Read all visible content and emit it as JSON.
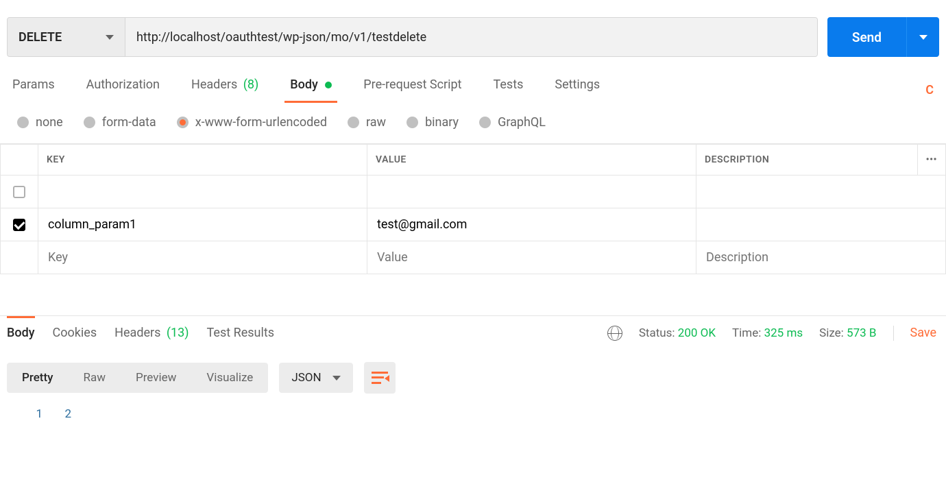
{
  "request": {
    "method": "DELETE",
    "url": "http://localhost/oauthtest/wp-json/mo/v1/testdelete",
    "send_label": "Send"
  },
  "request_tabs": {
    "params": "Params",
    "authorization": "Authorization",
    "headers": "Headers",
    "headers_count": "(8)",
    "body": "Body",
    "prerequest": "Pre-request Script",
    "tests": "Tests",
    "settings": "Settings",
    "right_action": "C"
  },
  "body_types": {
    "none": "none",
    "formdata": "form-data",
    "urlenc": "x-www-form-urlencoded",
    "raw": "raw",
    "binary": "binary",
    "graphql": "GraphQL"
  },
  "kv": {
    "headers": {
      "key": "KEY",
      "value": "VALUE",
      "desc": "DESCRIPTION"
    },
    "rows": [
      {
        "checked": false,
        "key": "",
        "value": "",
        "desc": ""
      },
      {
        "checked": true,
        "key": "column_param1",
        "value": "test@gmail.com",
        "desc": ""
      }
    ],
    "placeholders": {
      "key": "Key",
      "value": "Value",
      "desc": "Description"
    }
  },
  "response_tabs": {
    "body": "Body",
    "cookies": "Cookies",
    "headers": "Headers",
    "headers_count": "(13)",
    "test_results": "Test Results"
  },
  "response_meta": {
    "status_label": "Status:",
    "status_value": "200 OK",
    "time_label": "Time:",
    "time_value": "325 ms",
    "size_label": "Size:",
    "size_value": "573 B",
    "save": "Save"
  },
  "response_body": {
    "view_modes": {
      "pretty": "Pretty",
      "raw": "Raw",
      "preview": "Preview",
      "visualize": "Visualize"
    },
    "format": "JSON",
    "lines": [
      "1",
      "2"
    ]
  }
}
